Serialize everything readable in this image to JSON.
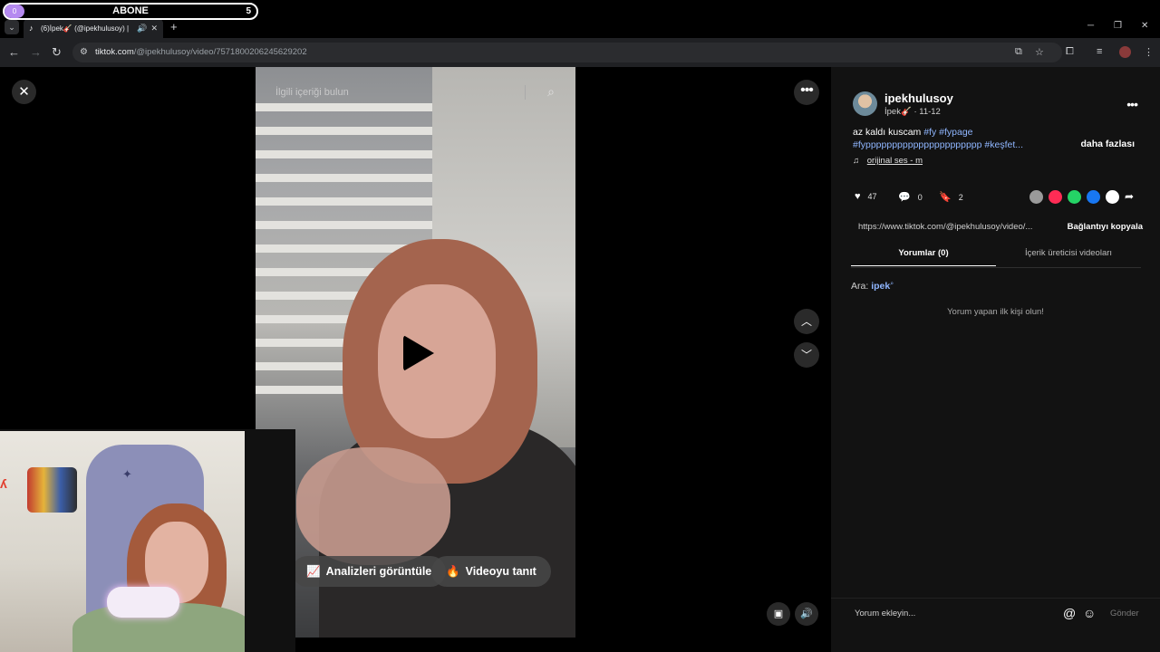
{
  "overlay": {
    "abone_label": "ABONE",
    "abone_count": "0",
    "abone_goal": "5"
  },
  "browser": {
    "tab_title": "(6)İpek🎸 (@ipekhulusoy) |",
    "new_tab": "+",
    "url_domain": "tiktok.com",
    "url_path": "/@ipekhulusoy/video/7571800206245629202"
  },
  "video": {
    "search_placeholder": "İlgili içeriği bulun",
    "analytics_label": "Analizleri görüntüle",
    "promote_label": "Videoyu tanıt"
  },
  "panel": {
    "username": "ipekhulusoy",
    "display_name": "İpek🎸",
    "date": "· 11-12",
    "caption_text": "az kaldı kuscam ",
    "tags": [
      "#fy",
      "#fypage",
      "#fypppppppppppppppppppppp",
      "#keşfet..."
    ],
    "see_more": "daha fazlası",
    "music": "orijinal ses - m",
    "likes": "47",
    "comments": "0",
    "saves": "2",
    "link_url": "https://www.tiktok.com/@ipekhulusoy/video/...",
    "copy_link": "Bağlantıyı kopyala",
    "tab_comments": "Yorumlar (0)",
    "tab_creator": "İçerik üreticisi videoları",
    "search_prefix": "Ara:",
    "search_keyword": "ipek",
    "empty_message": "Yorum yapan ilk kişi olun!",
    "comment_placeholder": "Yorum ekleyin...",
    "send": "Gönder"
  },
  "colors": {
    "accent_tag": "#8fb6ff",
    "panel_bg": "#121212",
    "share_colors": [
      "#9a9a9a",
      "#fe2c55",
      "#25d366",
      "#1877f2",
      "#ffffff"
    ]
  }
}
